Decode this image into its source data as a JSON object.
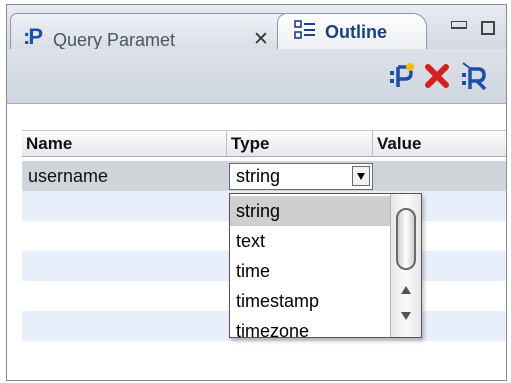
{
  "tabs": {
    "query_parameters": {
      "label": "Query Paramet",
      "icon": "query-parameters-icon",
      "close_icon": "close-icon"
    },
    "outline": {
      "label": "Outline",
      "icon": "outline-icon"
    }
  },
  "view_controls": {
    "minimize": "minimize-icon",
    "maximize": "maximize-icon"
  },
  "toolbar": {
    "buttons": [
      "add-parameter-icon",
      "delete-icon",
      "remove-all-icon"
    ],
    "colors": {
      "add": "#1e4fa8",
      "delete": "#d42020"
    }
  },
  "table": {
    "columns": [
      "Name",
      "Type",
      "Value"
    ],
    "rows": [
      {
        "name": "username",
        "type": "string",
        "value": ""
      }
    ]
  },
  "type_dropdown": {
    "selected": "string",
    "options": [
      "string",
      "text",
      "time",
      "timestamp",
      "timezone"
    ]
  }
}
